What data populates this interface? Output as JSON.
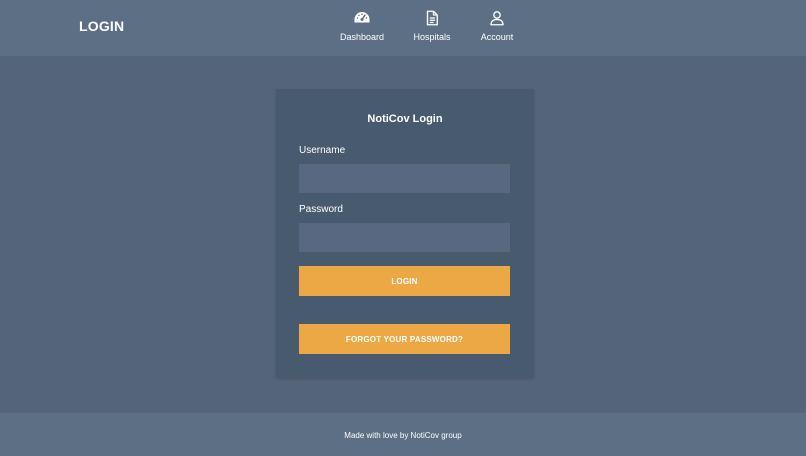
{
  "header": {
    "brand": "LOGIN",
    "nav": [
      {
        "label": "Dashboard",
        "icon": "dashboard-gauge-icon"
      },
      {
        "label": "Hospitals",
        "icon": "document-icon"
      },
      {
        "label": "Account",
        "icon": "user-icon"
      }
    ]
  },
  "login": {
    "title": "NotiCov Login",
    "username_label": "Username",
    "username_value": "",
    "password_label": "Password",
    "password_value": "",
    "login_button": "LOGIN",
    "forgot_button": "FORGOT YOUR PASSWORD?"
  },
  "footer": {
    "text": "Made with love by NotiCov group"
  },
  "colors": {
    "header_bg": "#5d6f84",
    "page_bg": "#546479",
    "card_bg": "#485a6e",
    "input_bg": "#586880",
    "accent": "#eba845"
  }
}
